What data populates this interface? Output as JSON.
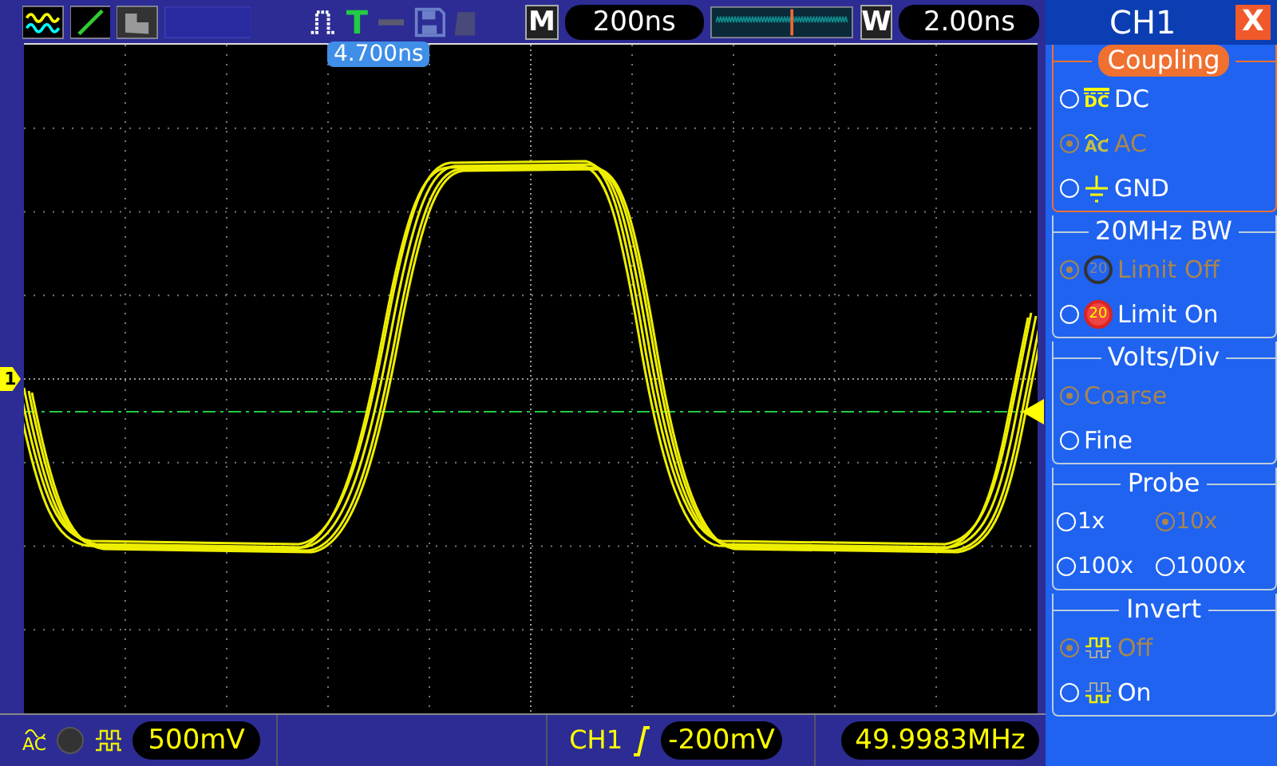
{
  "top_bar": {
    "trigger_mode": "T",
    "menu_key": "M",
    "time_base": "200ns",
    "window_key": "W",
    "window_time_base": "2.00ns"
  },
  "trigger_position": "4.700ns",
  "channel_marker": "1",
  "panel": {
    "title": "CH1",
    "close": "X",
    "groups": [
      {
        "title": "Coupling",
        "highlighted": true,
        "kind": "list",
        "options": [
          {
            "label": "DC",
            "icon_text": "DC",
            "selected": false
          },
          {
            "label": "AC",
            "icon_text": "AC",
            "selected": true
          },
          {
            "label": "GND",
            "selected": false
          }
        ]
      },
      {
        "title": "20MHz BW",
        "highlighted": false,
        "kind": "list",
        "options": [
          {
            "label": "Limit Off",
            "icon_text": "20",
            "selected": true
          },
          {
            "label": "Limit On",
            "icon_text": "20",
            "selected": false
          }
        ]
      },
      {
        "title": "Volts/Div",
        "highlighted": false,
        "kind": "list",
        "options": [
          {
            "label": "Coarse",
            "selected": true
          },
          {
            "label": "Fine",
            "selected": false
          }
        ]
      },
      {
        "title": "Probe",
        "highlighted": false,
        "kind": "grid",
        "options": [
          {
            "label": "1x",
            "selected": false
          },
          {
            "label": "10x",
            "selected": true
          },
          {
            "label": "100x",
            "selected": false
          },
          {
            "label": "1000x",
            "selected": false
          }
        ]
      },
      {
        "title": "Invert",
        "highlighted": false,
        "kind": "list",
        "options": [
          {
            "label": "Off",
            "selected": true
          },
          {
            "label": "On",
            "selected": false
          }
        ]
      }
    ]
  },
  "bottom_bar": {
    "coupling_text": "AC",
    "volts_per_div": "500mV",
    "trigger_source": "CH1",
    "trigger_level": "-200mV",
    "frequency": "49.9983MHz"
  }
}
